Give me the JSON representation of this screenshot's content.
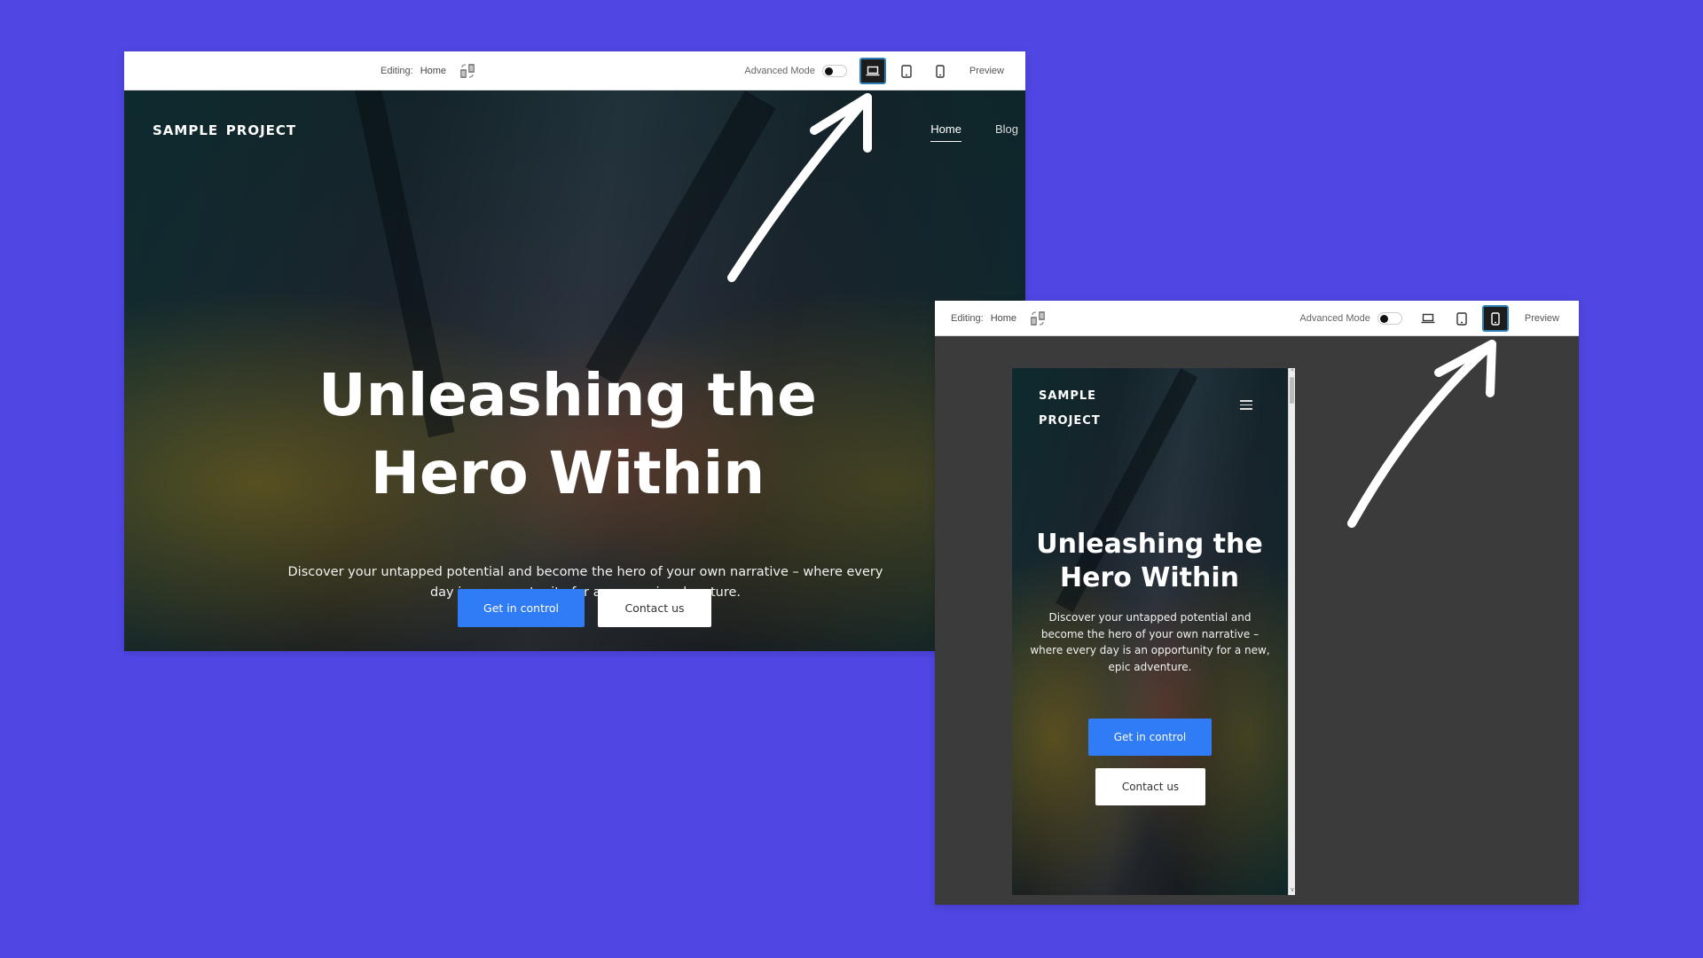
{
  "colors": {
    "background": "#5046e4",
    "primary_button": "#2f7cf6",
    "active_device": "#1d1d1d",
    "active_device_border": "#2e7fb8",
    "canvas_dark": "#3b3b3b"
  },
  "desktop_editor": {
    "toolbar": {
      "editing_label": "Editing:",
      "page_name": "Home",
      "page_switch_icon": "page-swap-icon",
      "advanced_mode_label": "Advanced Mode",
      "advanced_mode_on": false,
      "devices": [
        {
          "name": "desktop",
          "icon": "laptop-icon",
          "active": true
        },
        {
          "name": "tablet",
          "icon": "tablet-icon",
          "active": false
        },
        {
          "name": "mobile",
          "icon": "phone-icon",
          "active": false
        }
      ],
      "preview_label": "Preview"
    },
    "site": {
      "logo": "sample project",
      "nav": [
        {
          "label": "Home",
          "active": true
        },
        {
          "label": "Blog",
          "active": false
        }
      ],
      "heading": "Unleashing the Hero Within",
      "subheading": "Discover your untapped potential and become the hero of your own narrative – where every day is an opportunity for a new, epic adventure.",
      "primary_cta": "Get in control",
      "secondary_cta": "Contact us"
    }
  },
  "mobile_editor": {
    "toolbar": {
      "editing_label": "Editing:",
      "page_name": "Home",
      "page_switch_icon": "page-swap-icon",
      "advanced_mode_label": "Advanced Mode",
      "advanced_mode_on": false,
      "devices": [
        {
          "name": "desktop",
          "icon": "laptop-icon",
          "active": false
        },
        {
          "name": "tablet",
          "icon": "tablet-icon",
          "active": false
        },
        {
          "name": "mobile",
          "icon": "phone-icon",
          "active": true
        }
      ],
      "preview_label": "Preview"
    },
    "site": {
      "logo_line1": "sample",
      "logo_line2": "project",
      "menu_icon": "hamburger-icon",
      "heading": "Unleashing the Hero Within",
      "subheading": "Discover your untapped potential and become the hero of your own narrative – where every day is an opportunity for a new, epic adventure.",
      "primary_cta": "Get in control",
      "secondary_cta": "Contact us"
    }
  },
  "annotations": [
    {
      "type": "hand-drawn-arrow",
      "points_to": "desktop device button"
    },
    {
      "type": "hand-drawn-arrow",
      "points_to": "mobile device button"
    }
  ]
}
